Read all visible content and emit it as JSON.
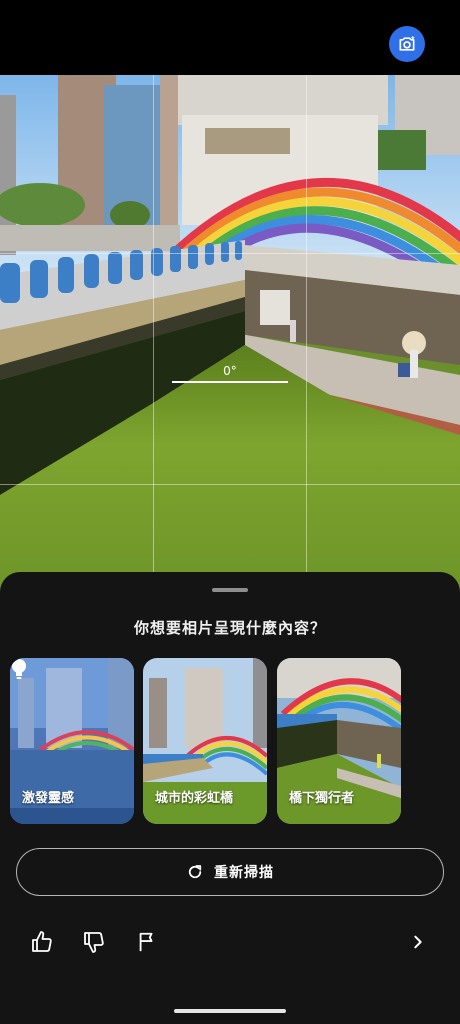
{
  "viewfinder": {
    "level_readout": "0°"
  },
  "camera_button": {
    "icon": "camera-sparkle-icon",
    "color": "#2f6fe8"
  },
  "sheet": {
    "question": "你想要相片呈現什麼內容？",
    "suggestions": [
      {
        "label": "激發靈感",
        "icon": "lightbulb-icon"
      },
      {
        "label": "城市的彩虹橋"
      },
      {
        "label": "橋下獨行者"
      }
    ],
    "rescan": {
      "label": "重新掃描",
      "icon": "refresh-icon"
    },
    "actions": [
      {
        "icon": "thumbs-up-icon"
      },
      {
        "icon": "thumbs-down-icon"
      },
      {
        "icon": "flag-icon"
      },
      {
        "icon": "chevron-right-icon"
      }
    ]
  }
}
